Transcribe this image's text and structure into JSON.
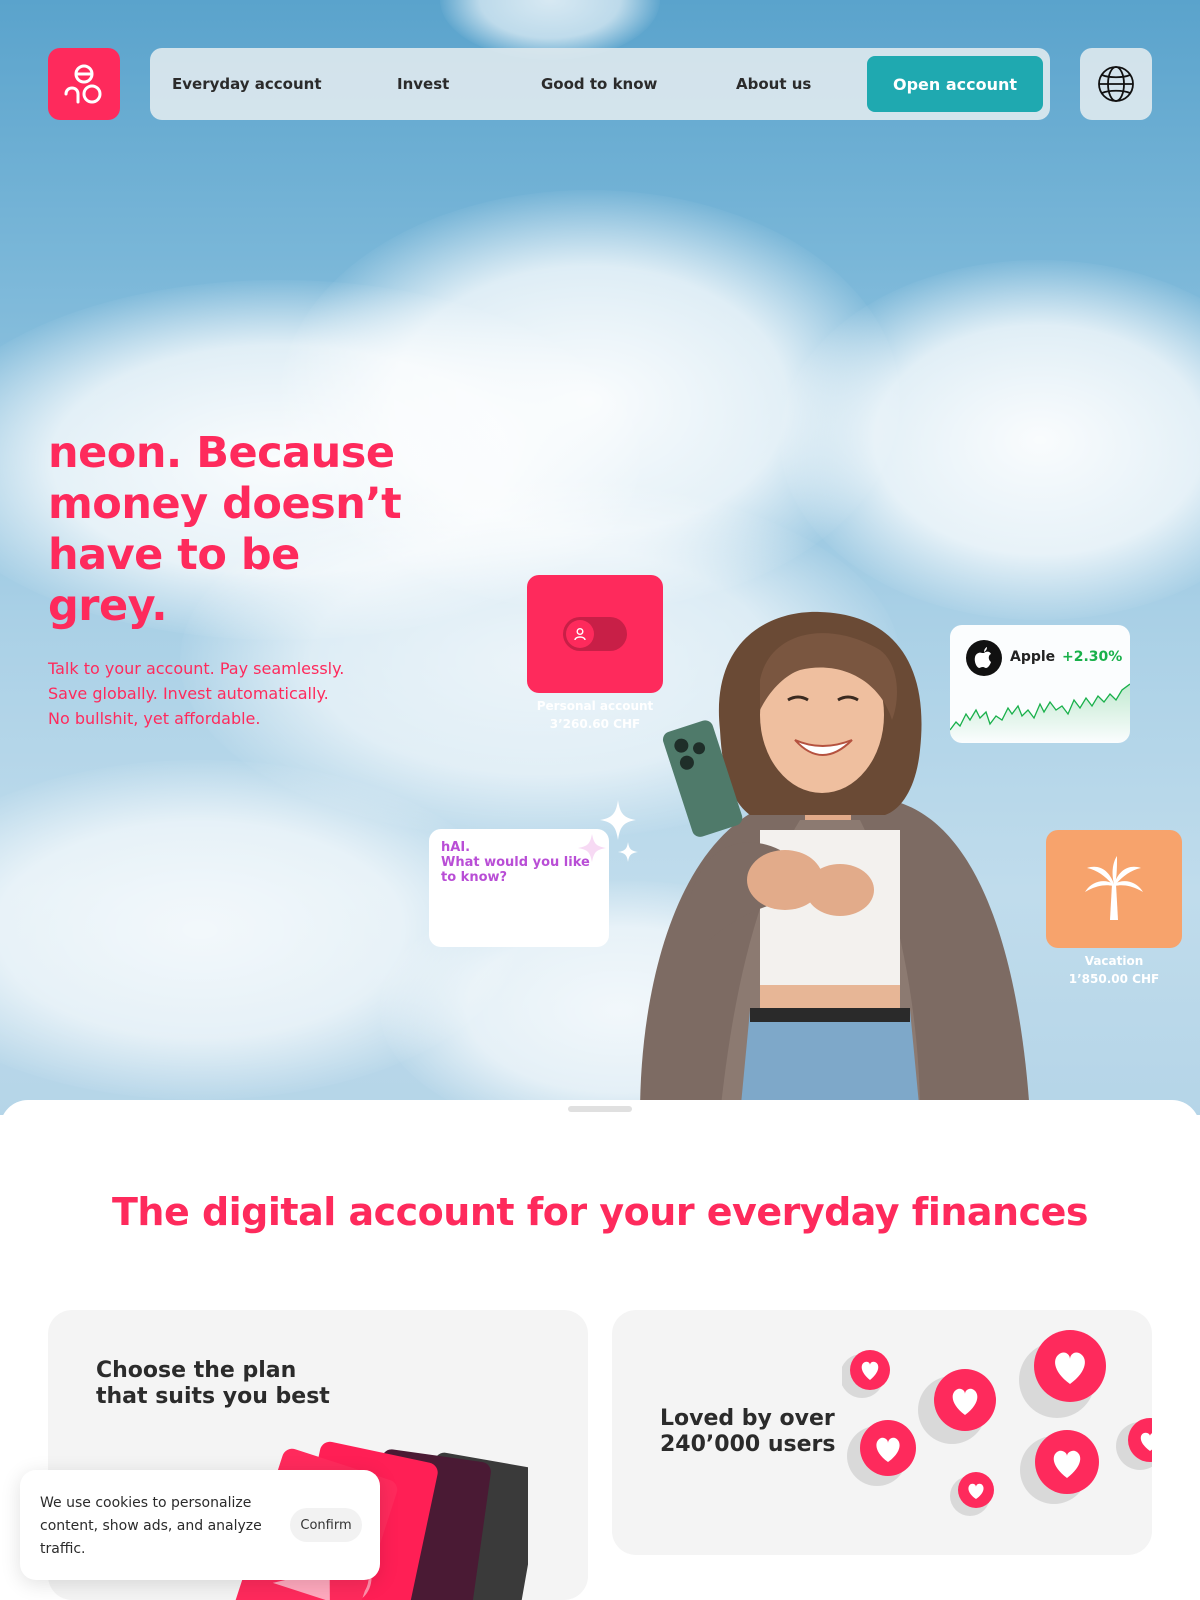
{
  "nav": {
    "items": [
      {
        "label": "Everyday account"
      },
      {
        "label": "Invest"
      },
      {
        "label": "Good to know"
      },
      {
        "label": "About us"
      }
    ],
    "cta_label": "Open account",
    "logo_icon": "neon-logo-icon",
    "globe_icon": "globe-icon"
  },
  "hero": {
    "headline": "neon. Because money doesn’t have to be grey.",
    "subline_1": "Talk to your account. Pay seamlessly.",
    "subline_2": "Save globally. Invest automatically.",
    "subline_3": "No bullshit, yet affordable."
  },
  "cards": {
    "personal": {
      "title": "Personal account",
      "amount": "3’260.60 CHF"
    },
    "apple": {
      "name": "Apple",
      "change": "+2.30%"
    },
    "hai": {
      "line1": "hAI.",
      "line2": "What would you like",
      "line3": "to know?"
    },
    "vacation": {
      "title": "Vacation",
      "amount": "1’850.00 CHF"
    }
  },
  "section": {
    "title": "The digital account for your everyday finances",
    "plan_title_1": "Choose the plan",
    "plan_title_2": "that suits you best",
    "loved_title_1": "Loved by over",
    "loved_title_2": "240’000 users"
  },
  "cookie": {
    "text": "We use cookies to personalize content, show ads, and analyze traffic.",
    "confirm_label": "Confirm"
  },
  "colors": {
    "brand": "#fe2a5c",
    "cta": "#1fa9b0",
    "positive": "#18b04a",
    "hai_purple": "#b94ed6",
    "vacation_orange": "#f7a36c"
  }
}
